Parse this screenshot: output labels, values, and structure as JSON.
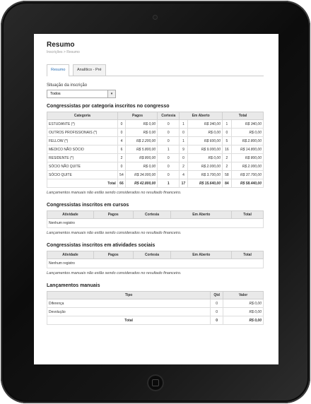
{
  "page": {
    "title": "Resumo",
    "breadcrumb": "Inscrições > Resumo"
  },
  "tabs": [
    {
      "label": "Resumo"
    },
    {
      "label": "Analítico - Pré"
    }
  ],
  "filter": {
    "label": "Situação da inscrição",
    "value": "Todos"
  },
  "congressistas": {
    "title": "Congressistas por categoria inscritos no congresso",
    "headers": [
      "Categoria",
      "Pagos",
      "Cortesia",
      "Em Aberto",
      "Total"
    ],
    "rows": [
      [
        "ESTUDANTE (*)",
        "0",
        "R$ 0,00",
        "0",
        "1",
        "R$ 340,00",
        "1",
        "R$ 340,00"
      ],
      [
        "OUTROS PROFISSIONAIS (*)",
        "0",
        "R$ 0,00",
        "0",
        "0",
        "R$ 0,00",
        "0",
        "R$ 0,00"
      ],
      [
        "FELLOW (*)",
        "4",
        "R$ 2.200,00",
        "0",
        "1",
        "R$ 600,00",
        "5",
        "R$ 2.800,00"
      ],
      [
        "MEDICO NÃO SÓCIO",
        "6",
        "R$ 5.800,00",
        "1",
        "9",
        "R$ 9.000,00",
        "16",
        "R$ 14.800,00"
      ],
      [
        "RESIDENTE (*)",
        "2",
        "R$ 800,00",
        "0",
        "0",
        "R$ 0,00",
        "2",
        "R$ 800,00"
      ],
      [
        "SÓCIO NÃO QUITE",
        "0",
        "R$ 0,00",
        "0",
        "2",
        "R$ 2.000,00",
        "2",
        "R$ 2.000,00"
      ],
      [
        "SÓCIO QUITE",
        "54",
        "R$ 34.000,00",
        "0",
        "4",
        "R$ 3.700,00",
        "58",
        "R$ 37.700,00"
      ]
    ],
    "total": [
      "Total",
      "66",
      "R$ 42.800,00",
      "1",
      "17",
      "R$ 15.640,00",
      "84",
      "R$ 58.440,00"
    ],
    "note": "Lançamentos manuais não estão sendo considerados no resultado financeiro."
  },
  "cursos": {
    "title": "Congressistas inscritos em cursos",
    "headers": [
      "Atividade",
      "Pagos",
      "Cortesia",
      "Em Aberto",
      "Total"
    ],
    "empty": "Nenhum registro",
    "note": "Lançamentos manuais não estão sendo considerados no resultado financeiro."
  },
  "sociais": {
    "title": "Congressistas inscritos em atividades sociais",
    "headers": [
      "Atividade",
      "Pagos",
      "Cortesia",
      "Em Aberto",
      "Total"
    ],
    "empty": "Nenhum registro",
    "note": "Lançamentos manuais não estão sendo considerados no resultado financeiro."
  },
  "manuais": {
    "title": "Lançamentos manuais",
    "headers": [
      "Tipo",
      "Qtd",
      "Valor"
    ],
    "rows": [
      [
        "Diferença",
        "0",
        "R$ 0,00"
      ],
      [
        "Devolução",
        "0",
        "R$ 0,00"
      ]
    ],
    "total": [
      "Total",
      "0",
      "R$ 0,00"
    ]
  }
}
